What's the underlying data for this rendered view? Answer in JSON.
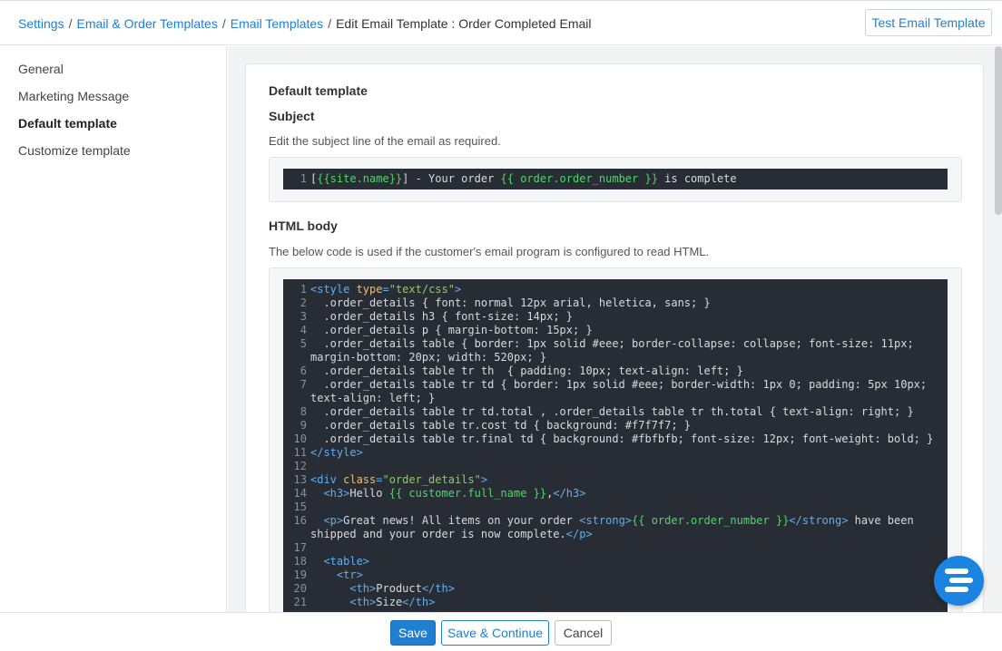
{
  "breadcrumb": {
    "settings": "Settings",
    "email_order_templates": "Email & Order Templates",
    "email_templates": "Email Templates",
    "current": "Edit Email Template : Order Completed Email"
  },
  "header": {
    "test_button": "Test Email Template"
  },
  "sidebar": {
    "items": [
      {
        "label": "General",
        "active": false
      },
      {
        "label": "Marketing Message",
        "active": false
      },
      {
        "label": "Default template",
        "active": true
      },
      {
        "label": "Customize template",
        "active": false
      }
    ]
  },
  "main": {
    "section_title": "Default template",
    "subject": {
      "title": "Subject",
      "hint": "Edit the subject line of the email as required."
    },
    "html_body": {
      "title": "HTML body",
      "hint": "The below code is used if the customer's email program is configured to read HTML."
    }
  },
  "subject_editor": {
    "lines": [
      {
        "n": "1",
        "tokens": [
          [
            "p",
            "["
          ],
          [
            "tpl",
            "{{site.name}}"
          ],
          [
            "p",
            "] - Your order "
          ],
          [
            "tpl",
            "{{ order.order_number }}"
          ],
          [
            "p",
            " is complete"
          ]
        ]
      }
    ]
  },
  "body_editor": {
    "lines": [
      {
        "n": "1",
        "tokens": [
          [
            "tag",
            "<style "
          ],
          [
            "attr",
            "type"
          ],
          [
            "tag",
            "="
          ],
          [
            "str",
            "\"text/css\""
          ],
          [
            "tag",
            ">"
          ]
        ]
      },
      {
        "n": "2",
        "tokens": [
          [
            "p",
            "  .order_details { font: normal 12px arial, heletica, sans; }"
          ]
        ]
      },
      {
        "n": "3",
        "tokens": [
          [
            "p",
            "  .order_details h3 { font-size: 14px; }"
          ]
        ]
      },
      {
        "n": "4",
        "tokens": [
          [
            "p",
            "  .order_details p { margin-bottom: 15px; }"
          ]
        ]
      },
      {
        "n": "5",
        "tokens": [
          [
            "p",
            "  .order_details table { border: 1px solid #eee; border-collapse: collapse; font-size: 11px; margin-bottom: 20px; width: 520px; }"
          ]
        ]
      },
      {
        "n": "6",
        "tokens": [
          [
            "p",
            "  .order_details table tr th  { padding: 10px; text-align: left; }"
          ]
        ]
      },
      {
        "n": "7",
        "tokens": [
          [
            "p",
            "  .order_details table tr td { border: 1px solid #eee; border-width: 1px 0; padding: 5px 10px; text-align: left; }"
          ]
        ]
      },
      {
        "n": "8",
        "tokens": [
          [
            "p",
            "  .order_details table tr td.total , .order_details table tr th.total { text-align: right; }"
          ]
        ]
      },
      {
        "n": "9",
        "tokens": [
          [
            "p",
            "  .order_details table tr.cost td { background: #f7f7f7; }"
          ]
        ]
      },
      {
        "n": "10",
        "tokens": [
          [
            "p",
            "  .order_details table tr.final td { background: #fbfbfb; font-size: 12px; font-weight: bold; }"
          ]
        ]
      },
      {
        "n": "11",
        "tokens": [
          [
            "tag",
            "</style>"
          ]
        ]
      },
      {
        "n": "12",
        "tokens": [
          [
            "p",
            ""
          ]
        ]
      },
      {
        "n": "13",
        "tokens": [
          [
            "tag",
            "<div "
          ],
          [
            "attr",
            "class"
          ],
          [
            "tag",
            "="
          ],
          [
            "str",
            "\"order_details\""
          ],
          [
            "tag",
            ">"
          ]
        ]
      },
      {
        "n": "14",
        "tokens": [
          [
            "p",
            "  "
          ],
          [
            "tag",
            "<h3>"
          ],
          [
            "p",
            "Hello "
          ],
          [
            "tpl",
            "{{ customer.full_name }}"
          ],
          [
            "p",
            ","
          ],
          [
            "tag",
            "</h3>"
          ]
        ]
      },
      {
        "n": "15",
        "tokens": [
          [
            "p",
            ""
          ]
        ]
      },
      {
        "n": "16",
        "tokens": [
          [
            "p",
            "  "
          ],
          [
            "tag",
            "<p>"
          ],
          [
            "p",
            "Great news! All items on your order "
          ],
          [
            "tag",
            "<strong>"
          ],
          [
            "tpl",
            "{{ order.order_number }}"
          ],
          [
            "tag",
            "</strong>"
          ],
          [
            "p",
            " have been shipped and your order is now complete."
          ],
          [
            "tag",
            "</p>"
          ]
        ]
      },
      {
        "n": "17",
        "tokens": [
          [
            "p",
            ""
          ]
        ]
      },
      {
        "n": "18",
        "tokens": [
          [
            "p",
            "  "
          ],
          [
            "tag",
            "<table>"
          ]
        ]
      },
      {
        "n": "19",
        "tokens": [
          [
            "p",
            "    "
          ],
          [
            "tag",
            "<tr>"
          ]
        ]
      },
      {
        "n": "20",
        "tokens": [
          [
            "p",
            "      "
          ],
          [
            "tag",
            "<th>"
          ],
          [
            "p",
            "Product"
          ],
          [
            "tag",
            "</th>"
          ]
        ]
      },
      {
        "n": "21",
        "tokens": [
          [
            "p",
            "      "
          ],
          [
            "tag",
            "<th>"
          ],
          [
            "p",
            "Size"
          ],
          [
            "tag",
            "</th>"
          ]
        ]
      }
    ]
  },
  "footer": {
    "save": "Save",
    "save_continue": "Save & Continue",
    "cancel": "Cancel"
  },
  "colors": {
    "accent": "#1f7fd1",
    "editor_bg": "#282c34",
    "tag": "#61afef",
    "attr": "#e5c07b",
    "string": "#98c379",
    "template_var": "#4cd964"
  },
  "icons": {
    "chat_widget": "chat-widget-icon"
  }
}
